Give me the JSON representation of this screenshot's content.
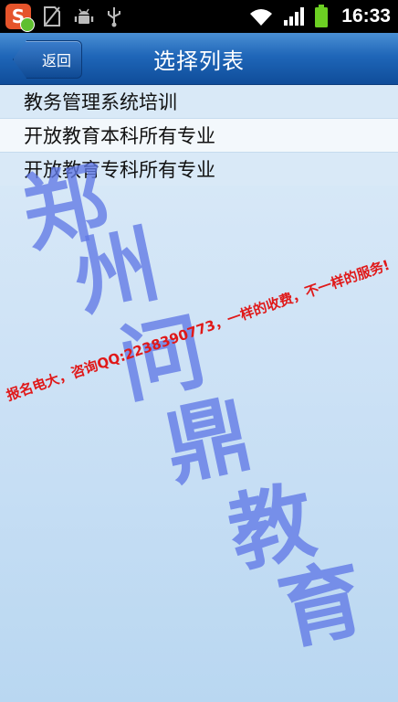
{
  "status_bar": {
    "time": "16:33",
    "left_icons": [
      "sogou-input-icon",
      "no-sim-icon",
      "android-debug-icon",
      "usb-icon"
    ],
    "right_icons": [
      "wifi-icon",
      "signal-icon",
      "battery-icon"
    ],
    "app_icon_letter": "S"
  },
  "header": {
    "back_label": "返回",
    "title": "选择列表"
  },
  "list": {
    "items": [
      {
        "label": "教务管理系统培训",
        "selected": false
      },
      {
        "label": "开放教育本科所有专业",
        "selected": true
      },
      {
        "label": "开放教育专科所有专业",
        "selected": false
      }
    ]
  },
  "watermark": {
    "chars": [
      "郑",
      "州",
      "问",
      "鼎",
      "教",
      "育"
    ],
    "promo_text": "报名电大，咨询QQ:2238390773，一样的收费，不一样的服务!"
  },
  "colors": {
    "title_bar": "#1f66b8",
    "list_bg": "#d9e9f7",
    "selected_bg": "#f3f8fc",
    "watermark_chars": "#6078e6",
    "watermark_text": "#e01919"
  }
}
